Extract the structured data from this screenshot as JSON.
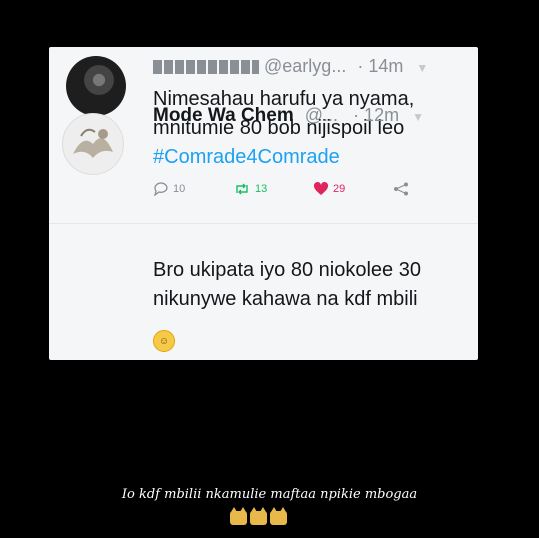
{
  "tweets": [
    {
      "handle": "@earlyg...",
      "time": "· 14m",
      "lines": [
        "Nimesahau harufu ya nyama,",
        "mnitumie 80 bob nijispoil leo"
      ],
      "hashtag": "#Comrade4Comrade",
      "replies": "10",
      "retweets": "13",
      "likes": "29"
    },
    {
      "name": "Mode Wa Chem",
      "handle": "@...",
      "time": "· 12m",
      "lines": [
        "Bro ukipata iyo 80 niokolee 30",
        "nikunywe kahawa na kdf mbili"
      ]
    }
  ],
  "caption": "Io kdf mbilii nkamulie maftaa npikie mbogaa",
  "colors": {
    "hashtag": "#1da1f2",
    "like": "#e0245e",
    "retweet": "#17bf63"
  },
  "icons": [
    "reply-icon",
    "retweet-icon",
    "heart-icon",
    "share-icon",
    "caret-icon",
    "laughing-emoji",
    "cat-emoji"
  ]
}
